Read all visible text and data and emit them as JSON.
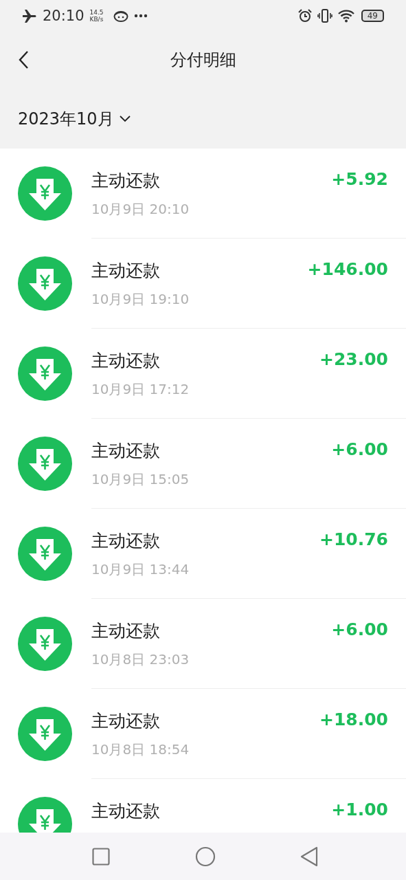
{
  "status_bar": {
    "time": "20:10",
    "speed_value": "14.5",
    "speed_unit": "KB/s",
    "battery": "49"
  },
  "header": {
    "title": "分付明细"
  },
  "month_filter": {
    "label": "2023年10月"
  },
  "transactions": [
    {
      "title": "主动还款",
      "date": "10月9日 20:10",
      "amount": "+5.92"
    },
    {
      "title": "主动还款",
      "date": "10月9日 19:10",
      "amount": "+146.00"
    },
    {
      "title": "主动还款",
      "date": "10月9日 17:12",
      "amount": "+23.00"
    },
    {
      "title": "主动还款",
      "date": "10月9日 15:05",
      "amount": "+6.00"
    },
    {
      "title": "主动还款",
      "date": "10月9日 13:44",
      "amount": "+10.76"
    },
    {
      "title": "主动还款",
      "date": "10月8日 23:03",
      "amount": "+6.00"
    },
    {
      "title": "主动还款",
      "date": "10月8日 18:54",
      "amount": "+18.00"
    },
    {
      "title": "主动还款",
      "amount": "+1.00"
    }
  ]
}
